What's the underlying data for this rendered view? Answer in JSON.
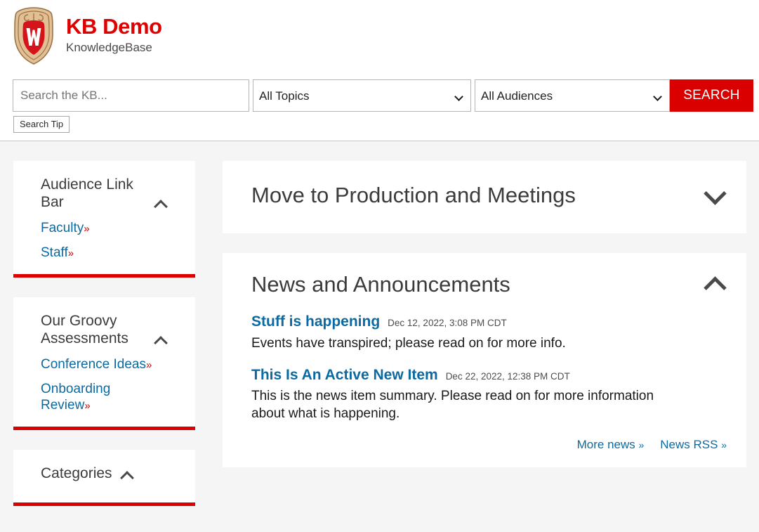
{
  "header": {
    "logo_icon": "uw-crest-logo",
    "brand_title": "KB Demo",
    "brand_subtitle": "KnowledgeBase"
  },
  "search": {
    "placeholder": "Search the KB...",
    "value": "",
    "topics_selected": "All Topics",
    "audiences_selected": "All Audiences",
    "search_button": "SEARCH",
    "search_tip_button": "Search Tip",
    "dropdown_icon": "chevron-down-icon"
  },
  "sidebar": {
    "cards": [
      {
        "title": "Audience Link Bar",
        "toggle_icon": "chevron-up-icon",
        "links": [
          {
            "label": "Faculty",
            "arrow": "»"
          },
          {
            "label": "Staff",
            "arrow": "»"
          }
        ]
      },
      {
        "title": "Our Groovy Assessments",
        "toggle_icon": "chevron-up-icon",
        "links": [
          {
            "label": "Conference Ideas",
            "arrow": "»"
          },
          {
            "label": "Onboarding Review",
            "arrow": "»"
          }
        ]
      },
      {
        "title": "Categories",
        "toggle_icon": "chevron-up-icon",
        "links": []
      }
    ]
  },
  "main": {
    "panels": [
      {
        "title": "Move to Production and Meetings",
        "toggle_icon": "chevron-down-icon",
        "collapsed": true
      },
      {
        "title": "News and Announcements",
        "toggle_icon": "chevron-up-icon",
        "collapsed": false
      }
    ],
    "news": [
      {
        "title": "Stuff is happening",
        "date": "Dec 12, 2022, 3:08 PM CDT",
        "summary": "Events have transpired; please read on for more info."
      },
      {
        "title": "This Is An Active New Item",
        "date": "Dec 22, 2022, 12:38 PM CDT",
        "summary": "This is the news item summary. Please read on for more information about what is happening."
      }
    ],
    "news_footer": [
      {
        "label": "More news",
        "arrow": "»"
      },
      {
        "label": "News RSS",
        "arrow": "»"
      }
    ]
  },
  "colors": {
    "brand_red": "#e00000",
    "search_button_red": "#da0000",
    "card_accent_red": "#dc0000",
    "link_blue": "#0b6aa2",
    "heading_gray": "#3b3b3b",
    "page_background": "#f5f5f5"
  }
}
